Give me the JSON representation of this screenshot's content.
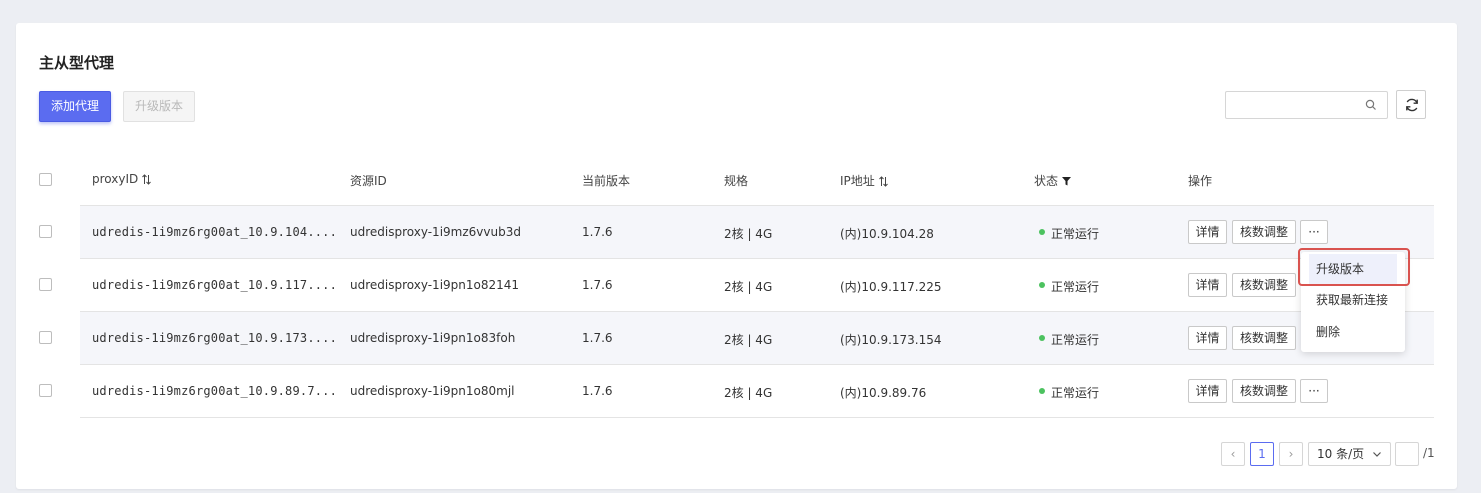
{
  "page": {
    "title": "主从型代理"
  },
  "toolbar": {
    "add_label": "添加代理",
    "upgrade_label": "升级版本",
    "search_placeholder": ""
  },
  "table": {
    "headers": {
      "proxy_id": "proxyID",
      "resource_id": "资源ID",
      "version": "当前版本",
      "spec": "规格",
      "ip": "IP地址",
      "status": "状态",
      "ops": "操作"
    },
    "rows": [
      {
        "proxy_id": "udredis-1i9mz6rg00at_10.9.104....",
        "resource_id": "udredisproxy-1i9mz6vvub3d",
        "version": "1.7.6",
        "spec": "2核 | 4G",
        "ip": "(内)10.9.104.28",
        "status": "正常运行"
      },
      {
        "proxy_id": "udredis-1i9mz6rg00at_10.9.117....",
        "resource_id": "udredisproxy-1i9pn1o82141",
        "version": "1.7.6",
        "spec": "2核 | 4G",
        "ip": "(内)10.9.117.225",
        "status": "正常运行"
      },
      {
        "proxy_id": "udredis-1i9mz6rg00at_10.9.173....",
        "resource_id": "udredisproxy-1i9pn1o83foh",
        "version": "1.7.6",
        "spec": "2核 | 4G",
        "ip": "(内)10.9.173.154",
        "status": "正常运行"
      },
      {
        "proxy_id": "udredis-1i9mz6rg00at_10.9.89.7...",
        "resource_id": "udredisproxy-1i9pn1o80mjl",
        "version": "1.7.6",
        "spec": "2核 | 4G",
        "ip": "(内)10.9.89.76",
        "status": "正常运行"
      }
    ],
    "op_labels": {
      "detail": "详情",
      "cores": "核数调整",
      "more": "···"
    }
  },
  "dropdown": {
    "items": [
      {
        "label": "升级版本"
      },
      {
        "label": "获取最新连接"
      },
      {
        "label": "删除"
      }
    ]
  },
  "pagination": {
    "prev": "‹",
    "current_page": "1",
    "next": "›",
    "page_size": "10 条/页",
    "jump_value": "",
    "total_pages": "/1"
  },
  "colors": {
    "primary": "#5b6cf0",
    "status_ok": "#4cc25f",
    "highlight": "#d9534f"
  }
}
